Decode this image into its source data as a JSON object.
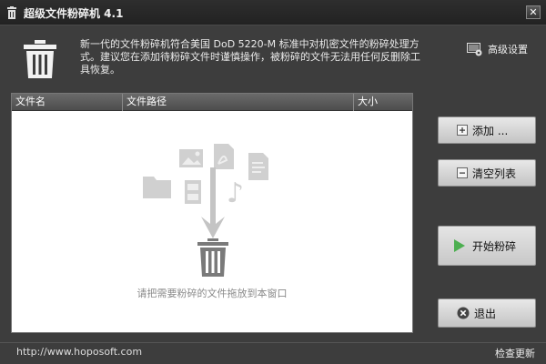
{
  "window": {
    "title": "超级文件粉碎机 4.1",
    "close_label": "✕"
  },
  "header": {
    "description": "新一代的文件粉碎机符合美国 DoD 5220-M 标准中对机密文件的粉碎处理方式。建议您在添加待粉碎文件时谨慎操作，被粉碎的文件无法用任何反删除工具恢复。",
    "advanced_settings": "高级设置"
  },
  "file_list": {
    "columns": {
      "name": "文件名",
      "path": "文件路径",
      "size": "大小"
    },
    "drop_hint": "请把需要粉碎的文件拖放到本窗口",
    "rows": []
  },
  "buttons": {
    "add": "添加 ...",
    "clear": "清空列表",
    "start": "开始粉碎",
    "exit": "退出"
  },
  "status": {
    "url": "http://www.hoposoft.com",
    "check_update": "检查更新"
  },
  "icons": {
    "title": "trash-icon",
    "header": "trash-bin-icon",
    "settings": "settings-icon",
    "add": "plus-icon",
    "clear": "minus-icon",
    "start": "play-icon",
    "exit": "close-circle-icon"
  },
  "colors": {
    "accent_start": "#4caf50",
    "window_bg": "#3d3d3d"
  }
}
